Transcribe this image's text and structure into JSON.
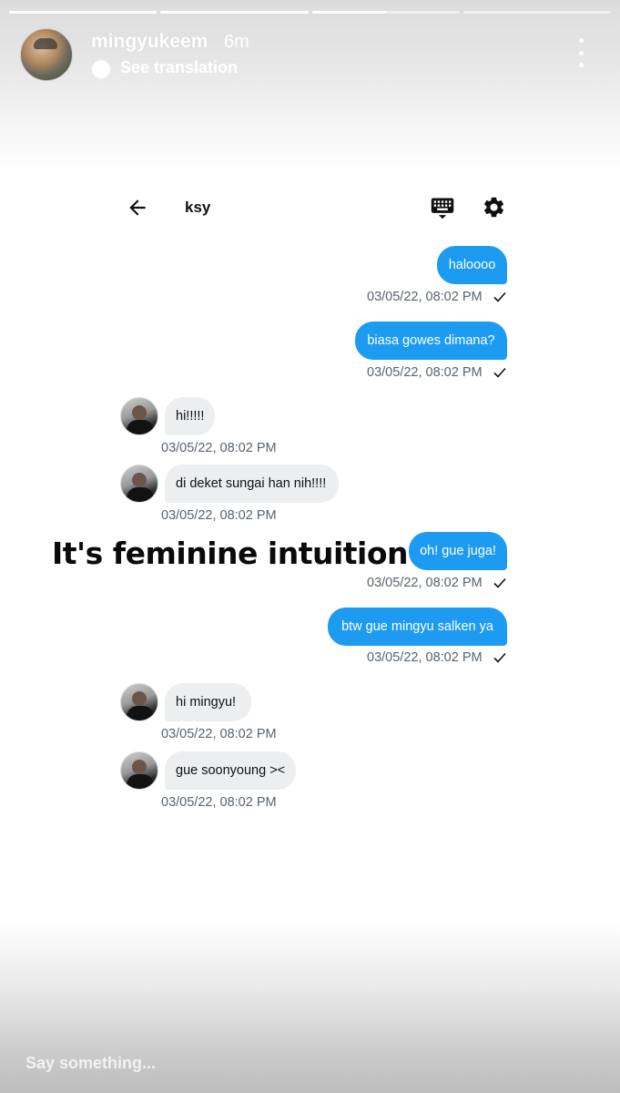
{
  "story": {
    "username": "mingyukeem",
    "time": "6m",
    "translation_label": "See translation",
    "progress": [
      1,
      1,
      0.5,
      0
    ],
    "reply_placeholder": "Say something..."
  },
  "caption": "It's feminine intuition",
  "chat": {
    "title": "ksy",
    "messages": [
      {
        "direction": "out",
        "text": "haloooo",
        "timestamp": "03/05/22, 08:02 PM",
        "read": true
      },
      {
        "direction": "out",
        "text": "biasa gowes dimana?",
        "timestamp": "03/05/22, 08:02 PM",
        "read": true
      },
      {
        "direction": "in",
        "text": "hi!!!!!",
        "timestamp": "03/05/22, 08:02 PM"
      },
      {
        "direction": "in",
        "text": "di deket sungai han nih!!!!",
        "timestamp": "03/05/22, 08:02 PM"
      },
      {
        "direction": "out",
        "text": "oh! gue juga!",
        "timestamp": "03/05/22, 08:02 PM",
        "read": true
      },
      {
        "direction": "out",
        "text": "btw gue mingyu salken ya",
        "timestamp": "03/05/22, 08:02 PM",
        "read": true
      },
      {
        "direction": "in",
        "text": "hi mingyu!",
        "timestamp": "03/05/22, 08:02 PM"
      },
      {
        "direction": "in",
        "text": "gue soonyoung ><",
        "timestamp": "03/05/22, 08:02 PM"
      }
    ]
  },
  "colors": {
    "outgoing_bubble": "#1d9bf0",
    "incoming_bubble": "#eceef0",
    "meta_text": "#59636e"
  },
  "icons": [
    "back-arrow-icon",
    "keyboard-icon",
    "gear-icon",
    "more-vertical-icon",
    "translate-icon",
    "checkmark-icon"
  ]
}
